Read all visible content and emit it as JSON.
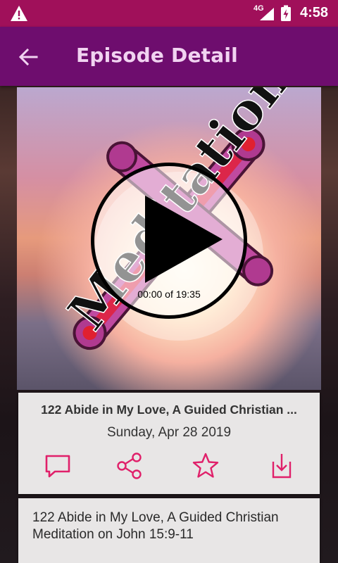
{
  "status_bar": {
    "network": "4G",
    "time": "4:58",
    "icons": [
      "warning-icon",
      "signal-icon",
      "battery-charging-icon"
    ]
  },
  "app_bar": {
    "title": "Episode Detail",
    "back_icon": "arrow-back-icon"
  },
  "player": {
    "time_label": "00:00 of 19:35",
    "play_icon": "play-icon"
  },
  "artwork": {
    "text": "Meditation"
  },
  "episode": {
    "title": "122 Abide in My Love, A Guided Christian ...",
    "date": "Sunday, Apr 28 2019",
    "actions": [
      {
        "name": "comment",
        "icon": "comment-icon"
      },
      {
        "name": "share",
        "icon": "share-icon"
      },
      {
        "name": "favorite",
        "icon": "star-icon"
      },
      {
        "name": "download",
        "icon": "download-icon"
      }
    ],
    "accent_color": "#e0206a"
  },
  "description": {
    "text": "122 Abide in My Love, A Guided Christian Meditation on John 15:9-11"
  },
  "colors": {
    "status_bar": "#a0105a",
    "app_bar": "#6e0d6e",
    "title_text": "#f1d3f1",
    "card_bg": "#e8e6e6"
  }
}
